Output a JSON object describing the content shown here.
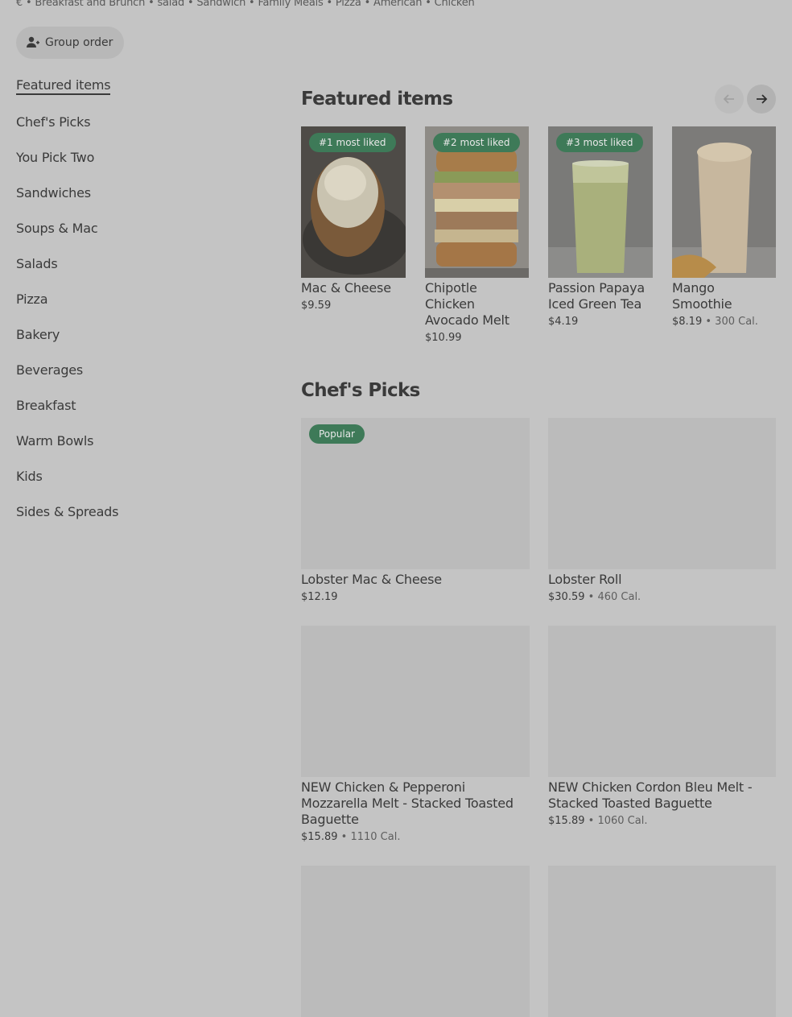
{
  "store": {
    "tags": "€ • Breakfast and Brunch • salad • Sandwich • Family Meals • Pizza • American • Chicken",
    "group_order_label": "Group order"
  },
  "sidebar": {
    "items": [
      {
        "label": "Featured items"
      },
      {
        "label": "Chef's Picks"
      },
      {
        "label": "You Pick Two"
      },
      {
        "label": "Sandwiches"
      },
      {
        "label": "Soups & Mac"
      },
      {
        "label": "Salads"
      },
      {
        "label": "Pizza"
      },
      {
        "label": "Bakery"
      },
      {
        "label": "Beverages"
      },
      {
        "label": "Breakfast"
      },
      {
        "label": "Warm Bowls"
      },
      {
        "label": "Kids"
      },
      {
        "label": "Sides & Spreads"
      }
    ]
  },
  "featured": {
    "title": "Featured items",
    "items": [
      {
        "badge": "#1 most liked",
        "name": "Mac & Cheese",
        "price": "$9.59",
        "cal": ""
      },
      {
        "badge": "#2 most liked",
        "name": "Chipotle Chicken Avocado Melt",
        "price": "$10.99",
        "cal": ""
      },
      {
        "badge": "#3 most liked",
        "name": "Passion Papaya Iced Green Tea",
        "price": "$4.19",
        "cal": ""
      },
      {
        "badge": "",
        "name": "Mango Smoothie",
        "price": "$8.19",
        "cal": "300 Cal."
      }
    ]
  },
  "chefs_picks": {
    "title": "Chef's Picks",
    "items": [
      {
        "badge": "Popular",
        "name": "Lobster Mac & Cheese",
        "price": "$12.19",
        "cal": ""
      },
      {
        "badge": "",
        "name": "Lobster Roll",
        "price": "$30.59",
        "cal": "460 Cal."
      },
      {
        "badge": "",
        "name": "NEW Chicken & Pepperoni Mozzarella Melt - Stacked Toasted Baguette",
        "price": "$15.89",
        "cal": "1110 Cal."
      },
      {
        "badge": "",
        "name": "NEW Chicken Cordon Bleu Melt - Stacked Toasted Baguette",
        "price": "$15.89",
        "cal": "1060 Cal."
      }
    ]
  },
  "separator": "•"
}
